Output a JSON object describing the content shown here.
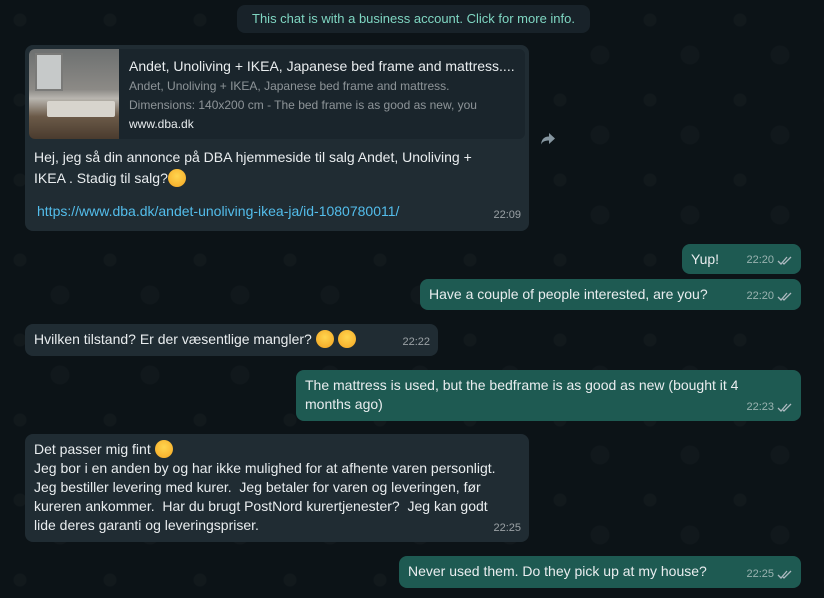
{
  "notice": "This chat is with a business account. Click for more info.",
  "messages": [
    {
      "direction": "in",
      "preview": {
        "title": "Andet, Unoliving + IKEA, Japanese bed frame and mattress....",
        "desc1": "Andet, Unoliving + IKEA, Japanese bed frame and mattress.",
        "desc2": "Dimensions: 140x200 cm - The bed frame is as good as new, you",
        "domain": "www.dba.dk"
      },
      "text1": "Hej, jeg så din annonce på DBA hjemmeside til salg Andet, Unoliving +",
      "text2": "IKEA . Stadig til salg?",
      "link": "https://www.dba.dk/andet-unoliving-ikea-ja/id-1080780011/",
      "time": "22:09"
    },
    {
      "direction": "out",
      "text": "Yup!",
      "time": "22:20"
    },
    {
      "direction": "out",
      "text": "Have a couple of people interested, are you?",
      "time": "22:20"
    },
    {
      "direction": "in",
      "text": "Hvilken tilstand?  Er der væsentlige mangler?",
      "time": "22:22"
    },
    {
      "direction": "out",
      "text": "The mattress is used, but the bedframe is as good as new (bought it 4\nmonths ago)",
      "time": "22:23"
    },
    {
      "direction": "in",
      "line1": "Det passer mig fint",
      "rest": "Jeg bor i en anden by og har ikke mulighed for at afhente varen personligt.\nJeg bestiller levering med kurer.  Jeg betaler for varen og leveringen, før\nkureren ankommer.  Har du brugt PostNord kurertjenester?  Jeg kan godt\nlide deres garanti og leveringspriser.",
      "time": "22:25"
    },
    {
      "direction": "out",
      "text": "Never used them. Do they pick up at my house?",
      "time": "22:25"
    }
  ],
  "icons": {
    "forward": "forward-icon",
    "read_receipt": "double-check-icon"
  },
  "colors": {
    "incoming": "#202c33",
    "outgoing": "#1e5a52",
    "link": "#53bdeb"
  }
}
